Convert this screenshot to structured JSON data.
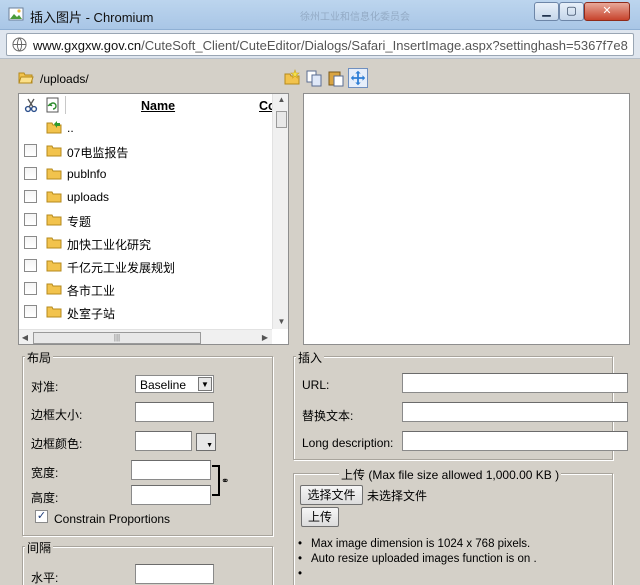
{
  "window": {
    "title": "插入图片 - Chromium",
    "background_tab_text": "徐州工业和信息化委员会",
    "controls": {
      "minimize": "▁",
      "maximize": "▢",
      "close": "✕"
    },
    "address": {
      "domain": "www.gxgxw.gov.cn",
      "path": "/CuteSoft_Client/CuteEditor/Dialogs/Safari_InsertImage.aspx?settinghash=5367f7e8"
    }
  },
  "browser": {
    "current_path": "/uploads/",
    "toolbar": [
      "new-folder-icon",
      "copy-icon",
      "paste-icon",
      "move-icon"
    ]
  },
  "file_list": {
    "header_name": "Name",
    "header_col2": "Co",
    "parent_label": "..",
    "items": [
      {
        "name": "07电监报告"
      },
      {
        "name": "publnfo"
      },
      {
        "name": "uploads"
      },
      {
        "name": "专题"
      },
      {
        "name": "加快工业化研究"
      },
      {
        "name": "千亿元工业发展规划"
      },
      {
        "name": "各市工业"
      },
      {
        "name": "处室子站"
      }
    ],
    "hscroll_grip": "|||"
  },
  "layout_section": {
    "legend": "布局",
    "align_label": "对准:",
    "align_value": "Baseline",
    "border_size_label": "边框大小:",
    "border_color_label": "边框颜色:",
    "width_label": "宽度:",
    "height_label": "高度:",
    "constrain_label": "Constrain Proportions",
    "constrain_checked": true
  },
  "spacing_section": {
    "legend": "间隔",
    "horizontal_label": "水平:"
  },
  "insert_section": {
    "legend": "插入",
    "url_label": "URL:",
    "alt_label": "替换文本:",
    "longdesc_label": "Long description:"
  },
  "upload_section": {
    "legend": "上传 (Max file size allowed 1,000.00 KB )",
    "choose_button": "选择文件",
    "no_file_text": "未选择文件",
    "upload_button": "上传",
    "notes": [
      "Max image dimension is 1024 x 768 pixels.",
      "Auto resize uploaded images function is on .",
      ""
    ]
  },
  "colors": {
    "dialog_bg": "#d4d0c8",
    "titlebar": "#a9c6e6",
    "close_button": "#c7432c",
    "folder": "#f2c34d"
  }
}
